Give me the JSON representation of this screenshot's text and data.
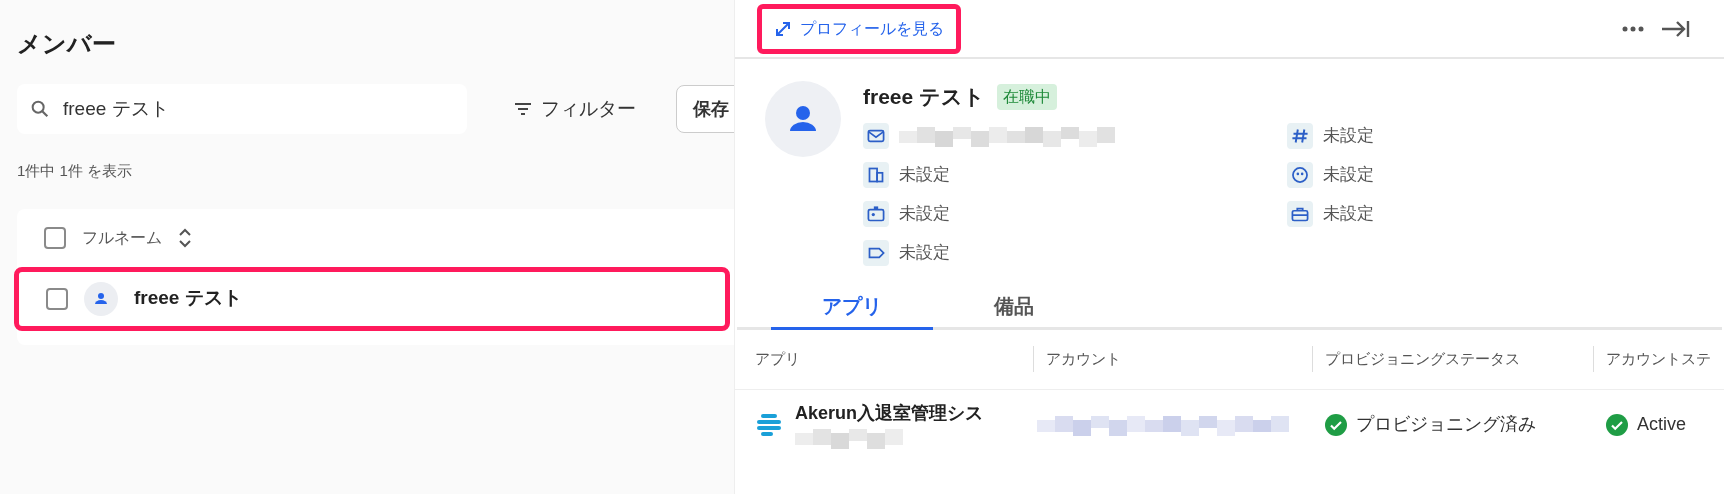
{
  "members": {
    "title": "メンバー",
    "search": {
      "value": "freee テスト"
    },
    "filter_button": "フィルター",
    "saved_button": "保存",
    "result_count": "1件中 1件 を表示",
    "table": {
      "columns": [
        "フルネーム"
      ],
      "rows": [
        {
          "name": "freee テスト",
          "checked": false,
          "highlighted": true
        }
      ],
      "header_checked": false
    }
  },
  "profile": {
    "open_link": "プロフィールを見る",
    "link_highlighted": true,
    "name": "freee テスト",
    "status": "在職中",
    "fields": [
      {
        "kind": "mail"
      },
      {
        "kind": "hash",
        "value": "未設定"
      },
      {
        "kind": "building",
        "value": "未設定"
      },
      {
        "kind": "face",
        "value": "未設定"
      },
      {
        "kind": "badge",
        "value": "未設定"
      },
      {
        "kind": "briefcase",
        "value": "未設定"
      },
      {
        "kind": "tag",
        "value": "未設定"
      }
    ],
    "tabs": [
      {
        "label": "アプリ",
        "selected": true
      },
      {
        "label": "備品",
        "selected": false
      }
    ],
    "apps_table": {
      "columns": [
        "アプリ",
        "アカウント",
        "プロビジョニングステータス",
        "アカウントステ"
      ],
      "rows": [
        {
          "app": "Akerun入退室管理シス",
          "provisioning": "プロビジョニング済み",
          "account_status": "Active"
        }
      ]
    }
  }
}
